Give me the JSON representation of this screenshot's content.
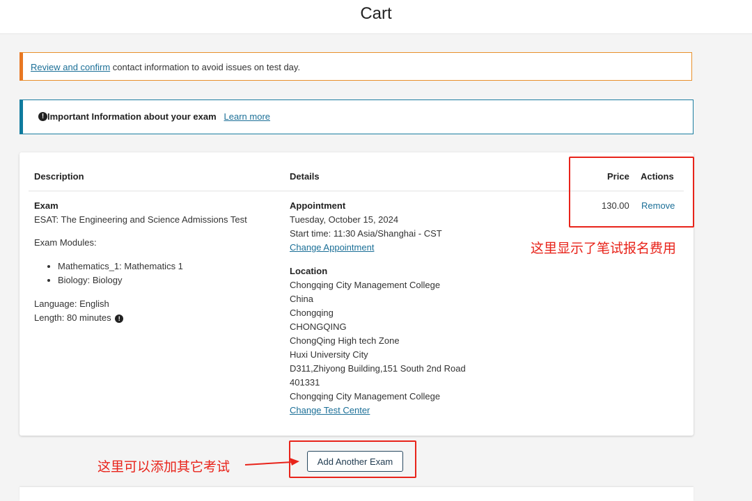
{
  "page": {
    "title": "Cart"
  },
  "alerts": {
    "contact": {
      "link_text": "Review and confirm",
      "text": " contact information to avoid issues on test day."
    },
    "important": {
      "icon": "info-icon",
      "text": "Important Information about your exam",
      "link_text": "Learn more"
    }
  },
  "table": {
    "headers": {
      "description": "Description",
      "details": "Details",
      "price": "Price",
      "actions": "Actions"
    },
    "row": {
      "exam_label": "Exam",
      "exam_name": "ESAT: The Engineering and Science Admissions Test",
      "modules_label": "Exam Modules:",
      "modules": [
        "Mathematics_1: Mathematics 1",
        "Biology: Biology"
      ],
      "language": "Language: English",
      "length": "Length: 80 minutes",
      "appointment_label": "Appointment",
      "appointment_date": "Tuesday, October 15, 2024",
      "start_time": "Start time: 11:30 Asia/Shanghai - CST",
      "change_appointment": "Change Appointment",
      "location_label": "Location",
      "location_lines": [
        "Chongqing City Management College",
        "China",
        "Chongqing",
        "CHONGQING",
        "ChongQing High tech Zone",
        "Huxi University City",
        "D311,Zhiyong Building,151 South 2nd Road",
        "401331",
        "Chongqing City Management College"
      ],
      "change_test_center": "Change Test Center",
      "price": "130.00",
      "remove": "Remove"
    }
  },
  "add_button": "Add Another Exam",
  "annotations": {
    "price_note": "这里显示了笔试报名费用",
    "add_note": "这里可以添加其它考试"
  },
  "colors": {
    "accent_link": "#1b6f97",
    "annotation_red": "#e8231a",
    "alert_orange": "#e87722",
    "alert_blue": "#0f7b9e"
  }
}
